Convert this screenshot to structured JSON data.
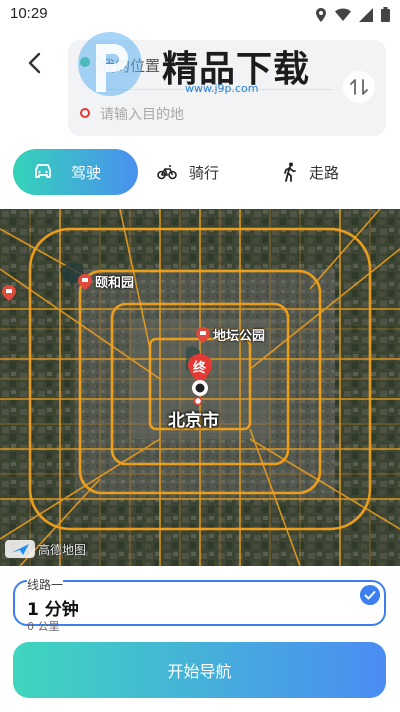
{
  "status_bar": {
    "time": "10:29"
  },
  "route": {
    "start_text": "我的位置",
    "end_placeholder": "请输入目的地"
  },
  "watermark": {
    "title": "精品下载",
    "url": "www.j9p.com"
  },
  "modes": [
    {
      "label": "驾驶",
      "icon": "car-icon",
      "active": true
    },
    {
      "label": "骑行",
      "icon": "bicycle-icon",
      "active": false
    },
    {
      "label": "走路",
      "icon": "walk-icon",
      "active": false
    }
  ],
  "map": {
    "pois": [
      {
        "label": "颐和园",
        "icon": "poi-marker-icon"
      },
      {
        "label": "地坛公园",
        "icon": "poi-marker-icon"
      }
    ],
    "city_label": "北京市",
    "end_marker_label": "终",
    "attribution": "高德地图",
    "colors": {
      "road": "#f4a21a",
      "satellite": "#3b4330"
    }
  },
  "route_option": {
    "name": "线路一",
    "time": "1 分钟",
    "distance": "0 公里",
    "selected": true
  },
  "start_button": {
    "label": "开始导航"
  },
  "colors": {
    "accent_start": "#34d3b8",
    "accent_end": "#4a90f0",
    "selected_border": "#3d7ff0"
  }
}
